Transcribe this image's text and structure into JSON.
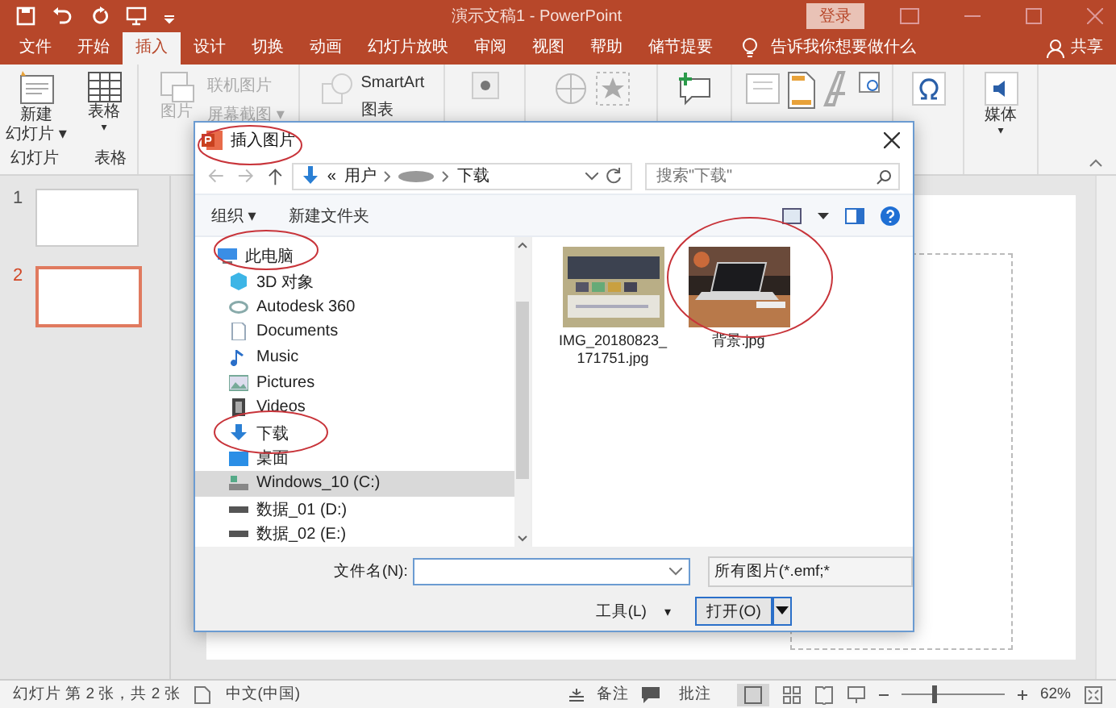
{
  "window": {
    "title": "演示文稿1  -  PowerPoint",
    "login_button": "登录"
  },
  "tabs": [
    {
      "label": "文件",
      "selected": false
    },
    {
      "label": "开始",
      "selected": false
    },
    {
      "label": "插入",
      "selected": true
    },
    {
      "label": "设计",
      "selected": false
    },
    {
      "label": "切换",
      "selected": false
    },
    {
      "label": "动画",
      "selected": false
    },
    {
      "label": "幻灯片放映",
      "selected": false
    },
    {
      "label": "审阅",
      "selected": false
    },
    {
      "label": "视图",
      "selected": false
    },
    {
      "label": "帮助",
      "selected": false
    },
    {
      "label": "储节提要",
      "selected": false
    }
  ],
  "tell_me": "告诉我你想要做什么",
  "share": "共享",
  "ribbon": {
    "new_slide": [
      "新建",
      "幻灯片 ▾"
    ],
    "table": "表格",
    "table_caret": "▾",
    "group_slides": "幻灯片",
    "group_table": "表格",
    "picture": "图片",
    "online_picture": "联机图片",
    "screenshot": "屏幕截图 ▾",
    "smartart": "SmartArt",
    "chart": "图表",
    "media": "媒体",
    "media_caret": "▾"
  },
  "slides": [
    {
      "number": "1",
      "selected": false
    },
    {
      "number": "2",
      "selected": true
    }
  ],
  "dialog": {
    "title": "插入图片",
    "breadcrumb": [
      "«",
      "用户",
      "下载"
    ],
    "search": {
      "placeholder": "搜索\"下载\""
    },
    "organize": "组织 ▾",
    "new_folder": "新建文件夹",
    "nav": [
      {
        "label": "此电脑",
        "kind": "pc",
        "selected": false,
        "children": [
          {
            "label": "3D 对象",
            "kind": "cube",
            "selected": false
          },
          {
            "label": "Autodesk 360",
            "kind": "cloud",
            "selected": false
          },
          {
            "label": "Documents",
            "kind": "doc",
            "selected": false
          },
          {
            "label": "Music",
            "kind": "music",
            "selected": false
          },
          {
            "label": "Pictures",
            "kind": "pictures",
            "selected": false
          },
          {
            "label": "Videos",
            "kind": "video",
            "selected": false
          },
          {
            "label": "下载",
            "kind": "download",
            "selected": false
          },
          {
            "label": "桌面",
            "kind": "desktop",
            "selected": false
          },
          {
            "label": "Windows_10 (C:)",
            "kind": "drive_c",
            "selected": true
          },
          {
            "label": "数据_01 (D:)",
            "kind": "drive",
            "selected": false
          },
          {
            "label": "数据_02 (E:)",
            "kind": "drive",
            "selected": false
          }
        ]
      }
    ],
    "files": [
      {
        "name": "IMG_20180823_\n171751.jpg",
        "kind": "picture"
      },
      {
        "name": "背景.jpg",
        "kind": "picture"
      }
    ],
    "filename_label": "文件名(N):",
    "filetype": "所有图片(*.emf;*",
    "tools": "工具(L)",
    "tools_caret": "▾",
    "open_button": "打开(O)"
  },
  "status_bar": {
    "slide_info": "幻灯片 第 2 张，共 2 张",
    "language": "中文(中国)",
    "notes": "备注",
    "comments": "批注",
    "zoom": {
      "level": 0.3,
      "reading": "62%"
    }
  }
}
